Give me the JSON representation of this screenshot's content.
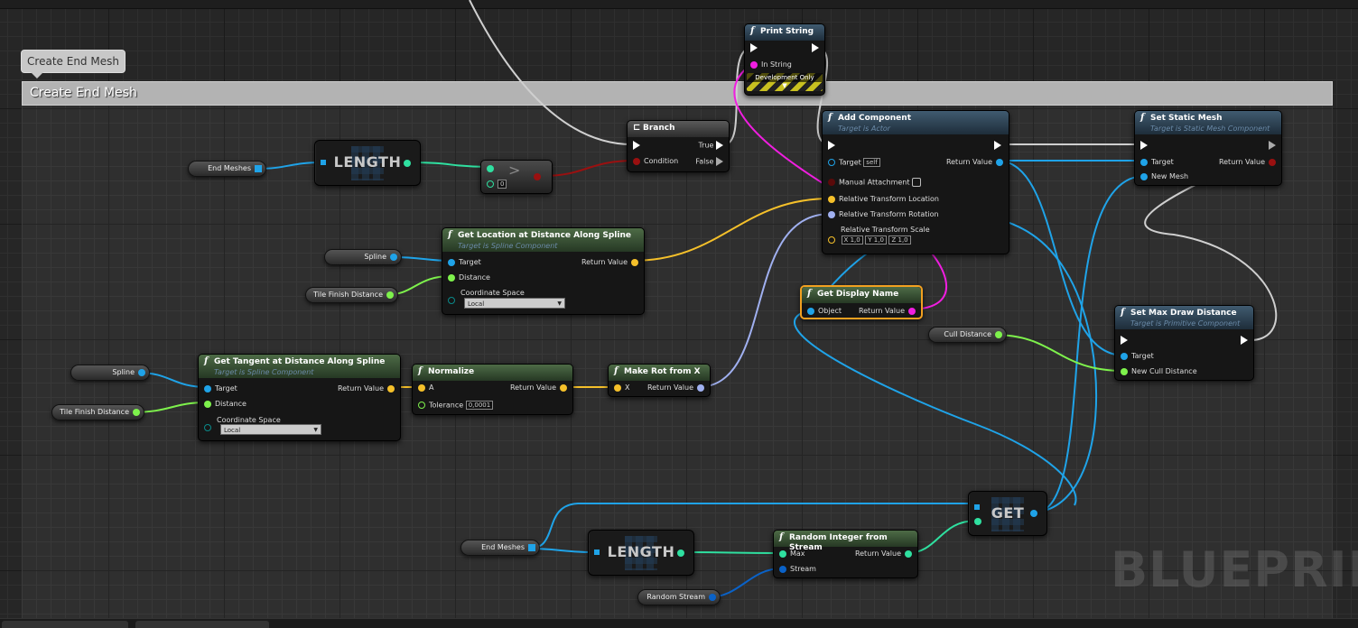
{
  "comment": {
    "bubble": "Create End Mesh",
    "title": "Create End Mesh"
  },
  "watermark": "BLUEPRINT",
  "nodes": {
    "print_string": {
      "title": "Print String",
      "in_string": "In String",
      "dev_only": "Development Only"
    },
    "branch": {
      "title": "Branch",
      "true": "True",
      "false": "False",
      "condition": "Condition"
    },
    "add_component": {
      "title": "Add Component",
      "subtitle": "Target is Actor",
      "target": "Target",
      "self": "self",
      "return": "Return Value",
      "manual": "Manual Attachment",
      "loc": "Relative Transform Location",
      "rot": "Relative Transform Rotation",
      "scale": "Relative Transform Scale",
      "x": "1,0",
      "y": "1,0",
      "z": "1,0"
    },
    "set_static_mesh": {
      "title": "Set Static Mesh",
      "subtitle": "Target is Static Mesh Component",
      "target": "Target",
      "return": "Return Value",
      "new_mesh": "New Mesh"
    },
    "get_location": {
      "title": "Get Location at Distance Along Spline",
      "subtitle": "Target is Spline Component",
      "target": "Target",
      "distance": "Distance",
      "return": "Return Value",
      "coord": "Coordinate Space",
      "coord_value": "Local"
    },
    "get_display_name": {
      "title": "Get Display Name",
      "object": "Object",
      "return": "Return Value"
    },
    "set_max_draw": {
      "title": "Set Max Draw Distance",
      "subtitle": "Target is Primitive Component",
      "target": "Target",
      "new_cull": "New Cull Distance"
    },
    "get_tangent": {
      "title": "Get Tangent at Distance Along Spline",
      "subtitle": "Target is Spline Component",
      "target": "Target",
      "distance": "Distance",
      "return": "Return Value",
      "coord": "Coordinate Space",
      "coord_value": "Local"
    },
    "normalize": {
      "title": "Normalize",
      "a": "A",
      "return": "Return Value",
      "tolerance": "Tolerance",
      "tol_value": "0,0001"
    },
    "make_rot": {
      "title": "Make Rot from X",
      "x": "X",
      "return": "Return Value"
    },
    "random_int": {
      "title": "Random Integer from Stream",
      "max": "Max",
      "stream": "Stream",
      "return": "Return Value"
    },
    "greater": {
      "value": "0"
    }
  },
  "macros": {
    "length1": "LENGTH",
    "length2": "LENGTH",
    "get": "GET"
  },
  "vars": {
    "end_meshes1": "End Meshes",
    "spline1": "Spline",
    "tile_finish1": "Tile Finish Distance",
    "spline2": "Spline",
    "tile_finish2": "Tile Finish Distance",
    "cull_distance": "Cull Distance",
    "end_meshes2": "End Meshes",
    "random_stream": "Random Stream"
  },
  "colors": {
    "object": "#1fa3e8",
    "float": "#7ef24c",
    "bool": "#9a1010",
    "vector": "#f5c02a",
    "rotator": "#a0b0f0",
    "string": "#f01ee0",
    "int": "#2fe0a0",
    "struct": "#0a62c8"
  }
}
